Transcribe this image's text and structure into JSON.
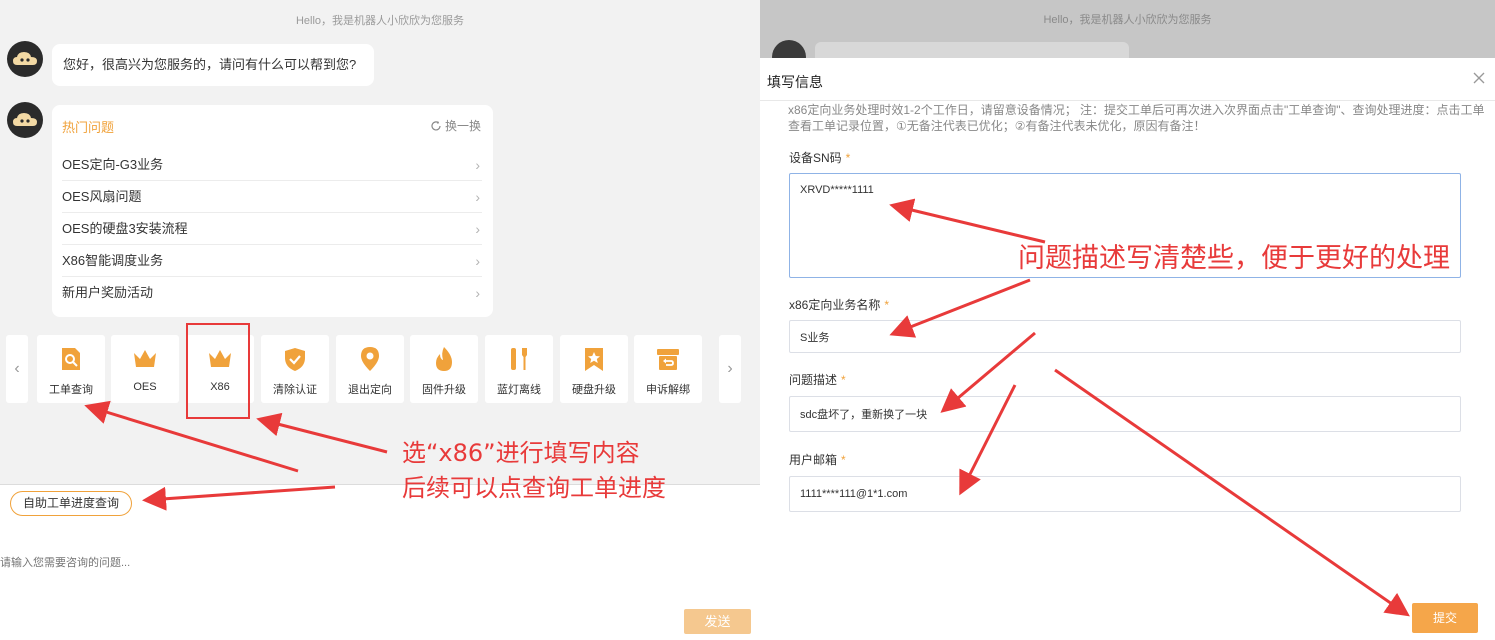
{
  "left": {
    "greeting": "Hello，我是机器人小欣欣为您服务",
    "welcome_message": "您好，很高兴为您服务的，请问有什么可以帮到您?",
    "hot": {
      "title": "热门问题",
      "refresh_label": "换一换",
      "items": [
        "OES定向-G3业务",
        "OES风扇问题",
        "OES的硬盘3安装流程",
        "X86智能调度业务",
        "新用户奖励活动"
      ]
    },
    "tiles": [
      {
        "label": "工单查询",
        "icon": "order-search-icon"
      },
      {
        "label": "OES",
        "icon": "crown-icon"
      },
      {
        "label": "X86",
        "icon": "crown-icon"
      },
      {
        "label": "清除认证",
        "icon": "shield-check-icon"
      },
      {
        "label": "退出定向",
        "icon": "location-pin-icon"
      },
      {
        "label": "固件升级",
        "icon": "flame-icon"
      },
      {
        "label": "蓝灯离线",
        "icon": "tools-icon"
      },
      {
        "label": "硬盘升级",
        "icon": "star-badge-icon"
      },
      {
        "label": "申诉解绑",
        "icon": "return-box-icon"
      }
    ],
    "progress_button": "自助工单进度查询",
    "input_placeholder": "请输入您需要咨询的问题...",
    "send_label": "发送",
    "annotation_line1": "选“x86”进行填写内容",
    "annotation_line2": "后续可以点查询工单进度"
  },
  "right": {
    "greeting": "Hello，我是机器人小欣欣为您服务",
    "modal_title": "填写信息",
    "notice": "x86定向业务处理时效1-2个工作日，请留意设备情况；  注：提交工单后可再次进入次界面点击\"工单查询\"、查询处理进度：点击工单查看工单记录位置，①无备注代表已优化；②有备注代表未优化，原因有备注！",
    "required_mark": "*",
    "fields": {
      "sn": {
        "label": "设备SN码",
        "value": "XRVD*****1111"
      },
      "business": {
        "label": "x86定向业务名称",
        "value": "S业务"
      },
      "description": {
        "label": "问题描述",
        "value": "sdc盘坏了，重新换了一块"
      },
      "email": {
        "label": "用户邮箱",
        "value": "1111****111@1*1.com"
      }
    },
    "submit_label": "提交",
    "annotation": "问题描述写清楚些，便于更好的处理"
  },
  "colors": {
    "accent": "#f0a23b",
    "annotation": "#e83a3a",
    "avatar": "#2b2b2b",
    "submit": "#f5a64a"
  }
}
